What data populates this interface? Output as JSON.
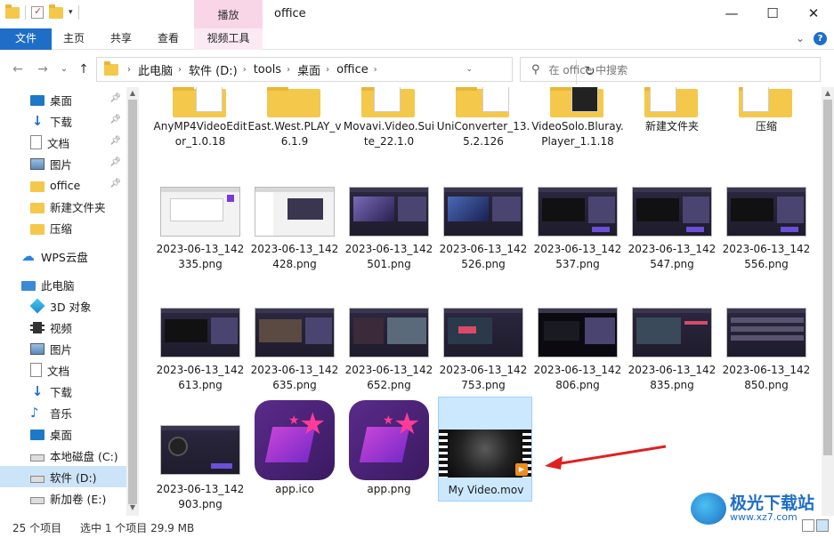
{
  "window": {
    "title": "office",
    "context_tab_title": "播放",
    "minimize": "—",
    "maximize": "☐",
    "close": "✕"
  },
  "ribbon": {
    "tabs": [
      "文件",
      "主页",
      "共享",
      "查看",
      "视频工具"
    ],
    "expand": "⌄",
    "help": "?"
  },
  "nav": {
    "back": "←",
    "forward": "→",
    "recent": "⌄",
    "up": "↑",
    "refresh": "↻",
    "breadcrumb": [
      "此电脑",
      "软件 (D:)",
      "tools",
      "桌面",
      "office"
    ],
    "search_placeholder": "在 office 中搜索"
  },
  "sidebar": {
    "items": [
      {
        "label": "桌面",
        "icon": "desktop-icon",
        "pinned": true
      },
      {
        "label": "下载",
        "icon": "download-icon",
        "pinned": true
      },
      {
        "label": "文档",
        "icon": "document-icon",
        "pinned": true
      },
      {
        "label": "图片",
        "icon": "picture-icon",
        "pinned": true
      },
      {
        "label": "office",
        "icon": "folder-icon",
        "pinned": true
      },
      {
        "label": "新建文件夹",
        "icon": "folder-icon",
        "pinned": false
      },
      {
        "label": "压缩",
        "icon": "folder-icon",
        "pinned": false
      },
      {
        "label": "WPS云盘",
        "icon": "cloud-icon",
        "pinned": false
      },
      {
        "label": "此电脑",
        "icon": "computer-icon",
        "pinned": false
      },
      {
        "label": "3D 对象",
        "icon": "3d-objects-icon",
        "pinned": false
      },
      {
        "label": "视频",
        "icon": "video-icon",
        "pinned": false
      },
      {
        "label": "图片",
        "icon": "picture-icon",
        "pinned": false
      },
      {
        "label": "文档",
        "icon": "document-icon",
        "pinned": false
      },
      {
        "label": "下载",
        "icon": "download-icon",
        "pinned": false
      },
      {
        "label": "音乐",
        "icon": "music-icon",
        "pinned": false
      },
      {
        "label": "桌面",
        "icon": "desktop-icon",
        "pinned": false
      },
      {
        "label": "本地磁盘 (C:)",
        "icon": "drive-icon",
        "pinned": false
      },
      {
        "label": "软件 (D:)",
        "icon": "drive-icon",
        "pinned": false
      },
      {
        "label": "新加卷 (E:)",
        "icon": "drive-icon",
        "pinned": false
      }
    ]
  },
  "files": {
    "row1": [
      {
        "name": "AnyMP4VideoEditor_1.0.18",
        "kind": "folder"
      },
      {
        "name": "East.West.PLAY_v6.1.9",
        "kind": "folder"
      },
      {
        "name": "Movavi.Video.Suite_22.1.0",
        "kind": "folder"
      },
      {
        "name": "UniConverter_13.5.2.126",
        "kind": "folder"
      },
      {
        "name": "VideoSolo.Bluray.Player_1.1.18",
        "kind": "folder"
      },
      {
        "name": "新建文件夹",
        "kind": "folder"
      },
      {
        "name": "压缩",
        "kind": "folder"
      }
    ],
    "row2": [
      {
        "name": "2023-06-13_142335.png",
        "style": "light-dialog"
      },
      {
        "name": "2023-06-13_142428.png",
        "style": "light-explorer"
      },
      {
        "name": "2023-06-13_142501.png",
        "style": "dark"
      },
      {
        "name": "2023-06-13_142526.png",
        "style": "dark"
      },
      {
        "name": "2023-06-13_142537.png",
        "style": "dark"
      },
      {
        "name": "2023-06-13_142547.png",
        "style": "dark"
      },
      {
        "name": "2023-06-13_142556.png",
        "style": "dark"
      }
    ],
    "row3": [
      {
        "name": "2023-06-13_142613.png",
        "style": "dark"
      },
      {
        "name": "2023-06-13_142635.png",
        "style": "dark"
      },
      {
        "name": "2023-06-13_142652.png",
        "style": "dark"
      },
      {
        "name": "2023-06-13_142753.png",
        "style": "dark"
      },
      {
        "name": "2023-06-13_142806.png",
        "style": "dark"
      },
      {
        "name": "2023-06-13_142835.png",
        "style": "dark"
      },
      {
        "name": "2023-06-13_142850.png",
        "style": "dark"
      }
    ],
    "row4": [
      {
        "name": "2023-06-13_142903.png",
        "style": "dark"
      },
      {
        "name": "app.ico",
        "style": "app-icon"
      },
      {
        "name": "app.png",
        "style": "app-icon"
      },
      {
        "name": "My Video.mov",
        "style": "video",
        "selected": true
      }
    ]
  },
  "status": {
    "count": "25 个项目",
    "selection": "选中 1 个项目  29.9 MB"
  },
  "watermark": {
    "brand": "极光下载站",
    "url": "www.xz7.com"
  }
}
